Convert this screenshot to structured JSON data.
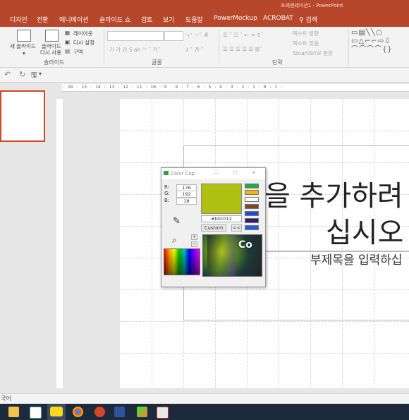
{
  "window": {
    "title": "프레젠테이션1 - PowerPoint"
  },
  "tabs": [
    "디자인",
    "전환",
    "애니메이션",
    "슬라이드 쇼",
    "검토",
    "보기",
    "도움말",
    "PowerMockup",
    "ACROBAT"
  ],
  "search": {
    "label": "검색"
  },
  "ribbon": {
    "new_slide": "새 슬라이드",
    "reuse_slide_1": "슬라이드",
    "reuse_slide_2": "다시 사용",
    "layout": "레이아웃",
    "reset": "다시 설정",
    "section": "구역",
    "group_slides": "슬라이드",
    "group_font": "글꼴",
    "group_paragraph": "단락",
    "text_direction": "텍스트 방향",
    "align_text": "텍스트 맞춤",
    "smartart": "SmartArt로 변환"
  },
  "ruler": {
    "marks": "· 16 · 15 · 14 · 13 · 12 · 11 · 10 · 9 · 8 · 7 · 6 · 5 · 4 · 3 · 2 · 1 · 0 · 1 ·"
  },
  "slide": {
    "title_line1": "을 추가하려",
    "title_line2": "십시오",
    "subtitle": "부제목을 입력하십"
  },
  "status": {
    "language": "국어"
  },
  "colorcop": {
    "title": "Color Cop",
    "min": "—",
    "max": "☐",
    "close": "✕",
    "r_label": "R:",
    "g_label": "G:",
    "b_label": "B:",
    "r": "176",
    "g": "192",
    "b": "18",
    "hex": "#b0c012",
    "custom_label": "Custom",
    "expand_label": "<<",
    "plus": "+",
    "minus": "−",
    "magnifier_text": "Co",
    "colors": {
      "current": "#b0c012",
      "history": [
        "#22a84a",
        "#f4b400",
        "#ffffff",
        "#7a4a1e",
        "#1a4fd8",
        "#3a1a6b",
        "#1f5ce8"
      ]
    }
  },
  "colors": {
    "accent": "#b7472a",
    "selection": "#d24726"
  }
}
